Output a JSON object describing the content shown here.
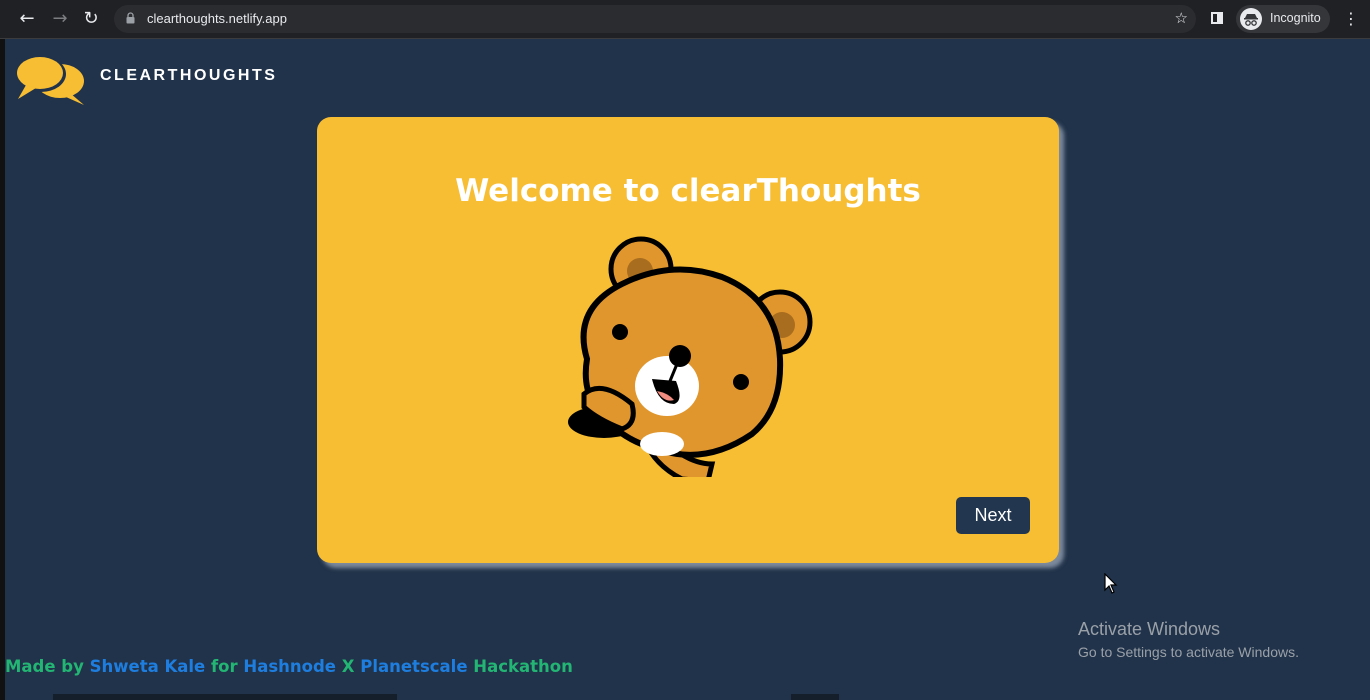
{
  "browser": {
    "url": "clearthoughts.netlify.app",
    "profile_label": "Incognito",
    "icons": [
      "back-icon",
      "forward-icon",
      "reload-icon",
      "lock-icon",
      "star-icon",
      "side-panel-icon",
      "incognito-icon",
      "menu-icon"
    ]
  },
  "header": {
    "brand": "CLEARTHOUGHTS",
    "logo_icon": "chat-bubbles-icon"
  },
  "card": {
    "title": "Welcome to clearThoughts",
    "illustration": "bear-illustration",
    "next_label": "Next"
  },
  "footer": {
    "made_by": "Made by",
    "author": "Shweta Kale",
    "for_text": "for",
    "org1": "Hashnode",
    "x_text": "X",
    "org2": "Planetscale",
    "event": "Hackathon"
  },
  "watermark": {
    "title": "Activate Windows",
    "subtitle": "Go to Settings to activate Windows."
  },
  "colors": {
    "background": "#21334a",
    "card": "#f7bd33",
    "button": "#223650",
    "footer_green": "#22b573",
    "footer_blue": "#1e7ee0"
  }
}
